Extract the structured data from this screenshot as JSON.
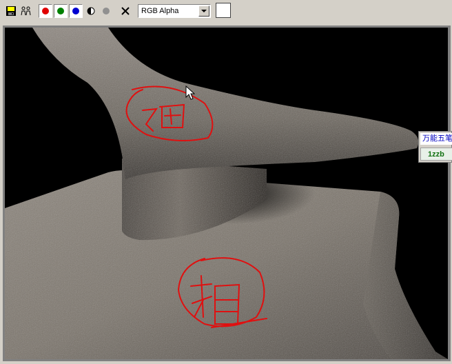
{
  "toolbar": {
    "buttons": [
      {
        "name": "save-icon"
      },
      {
        "name": "clone-icon"
      },
      {
        "name": "red-channel-toggle",
        "color": "#e00000"
      },
      {
        "name": "green-channel-toggle",
        "color": "#008000"
      },
      {
        "name": "blue-channel-toggle",
        "color": "#0000d0"
      },
      {
        "name": "mono-toggle-icon"
      },
      {
        "name": "alpha-toggle-icon"
      },
      {
        "name": "clear-icon"
      }
    ],
    "channel_select": {
      "selected": "RGB Alpha"
    },
    "color_swatch": "#ffffff"
  },
  "viewport": {
    "background": "#000000",
    "annotation_color": "#e01010"
  },
  "ime_popup": {
    "name": "万能五笔",
    "code": "1zzb"
  }
}
